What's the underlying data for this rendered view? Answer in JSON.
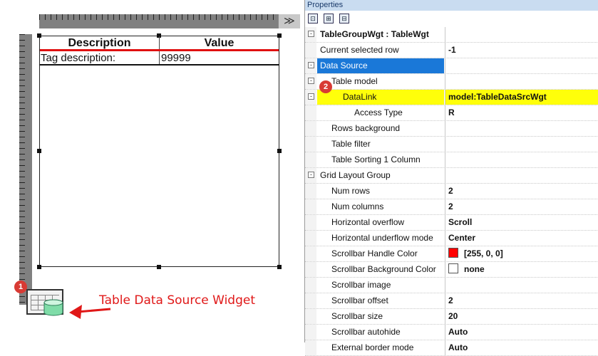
{
  "editor": {
    "header_description": "Description",
    "header_value": "Value",
    "row_label": "Tag description:",
    "row_value": "99999",
    "ruler_button": "≫"
  },
  "annotation": {
    "badge1": "1",
    "badge2": "2",
    "text": "Table Data Source Widget"
  },
  "panel": {
    "title": "Properties",
    "rows": [
      {
        "name": "TableGroupWgt : TableWgt",
        "value": "",
        "expander": "-"
      },
      {
        "name": "Current selected row",
        "value": "-1"
      },
      {
        "name": "Data Source",
        "value": "",
        "expander": "-"
      },
      {
        "name": "Table model",
        "value": "",
        "expander": "-"
      },
      {
        "name": "DataLink",
        "value": "model:TableDataSrcWgt",
        "expander": "-"
      },
      {
        "name": "Access Type",
        "value": "R"
      },
      {
        "name": "Rows background",
        "value": ""
      },
      {
        "name": "Table filter",
        "value": ""
      },
      {
        "name": "Table Sorting 1 Column",
        "value": ""
      },
      {
        "name": "Grid Layout Group",
        "value": "",
        "expander": "-"
      },
      {
        "name": "Num rows",
        "value": "2"
      },
      {
        "name": "Num columns",
        "value": "2"
      },
      {
        "name": "Horizontal overflow",
        "value": "Scroll"
      },
      {
        "name": "Horizontal underflow mode",
        "value": "Center"
      },
      {
        "name": "Scrollbar Handle Color",
        "value": "[255, 0, 0]",
        "swatch": "#ff0000"
      },
      {
        "name": "Scrollbar Background Color",
        "value": "none",
        "swatch": "#ffffff"
      },
      {
        "name": "Scrollbar image",
        "value": ""
      },
      {
        "name": "Scrollbar offset",
        "value": "2"
      },
      {
        "name": "Scrollbar size",
        "value": "20"
      },
      {
        "name": "Scrollbar autohide",
        "value": "Auto"
      },
      {
        "name": "External border mode",
        "value": "Auto"
      }
    ]
  },
  "colors": {
    "selected_row": "#1a78d8",
    "highlight_row": "#ffff0a",
    "annotation_red": "#e01818"
  },
  "icons": [
    "categorized-icon",
    "alphabetical-icon",
    "property-pages-icon",
    "table-datasource-icon",
    "database-icon"
  ]
}
